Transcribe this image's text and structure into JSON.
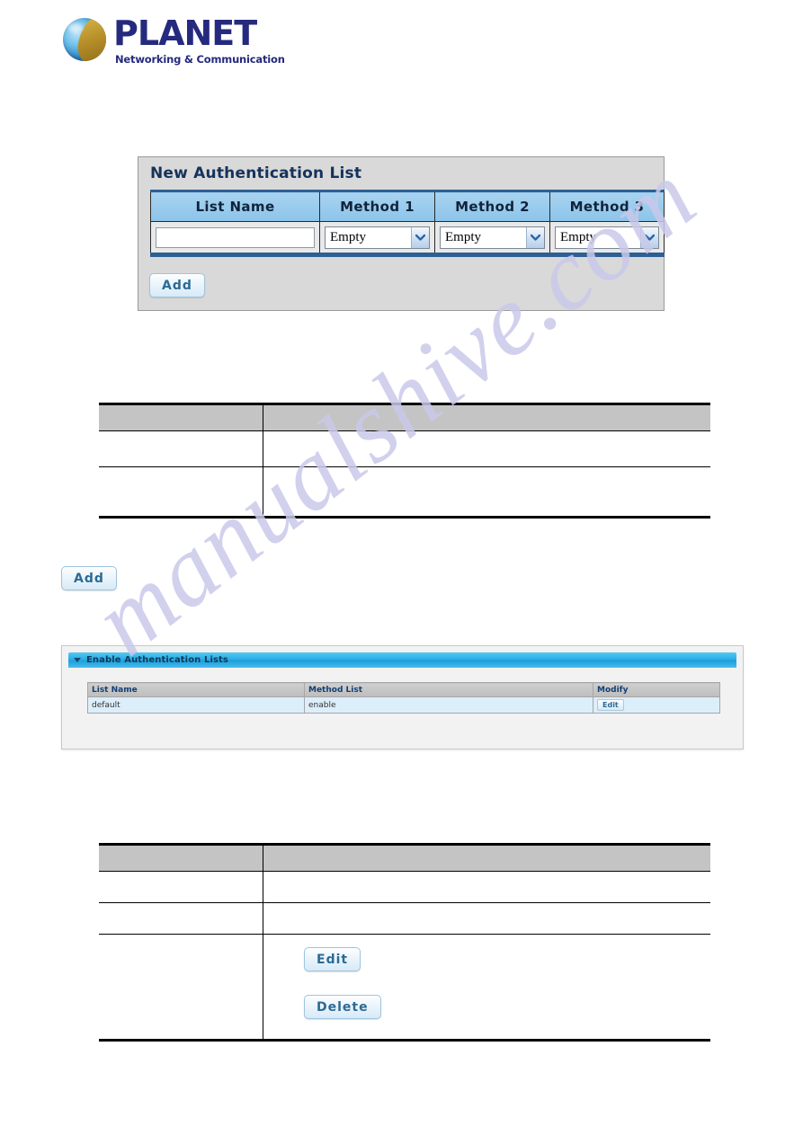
{
  "brand": {
    "name": "PLANET",
    "tagline": "Networking & Communication",
    "logo_icon": "planet-globe-icon",
    "wordmark_color": "#252a7e"
  },
  "watermark": {
    "text": "manualshive.com",
    "color": "#c9c9ea"
  },
  "new_auth_panel": {
    "title": "New Authentication List",
    "columns": [
      "List Name",
      "Method 1",
      "Method 2",
      "Method 3"
    ],
    "list_name_value": "",
    "list_name_placeholder": "",
    "method1_value": "Empty",
    "method2_value": "Empty",
    "method3_value": "Empty",
    "dropdown_icon": "chevron-down-icon",
    "add_label": "Add",
    "header_color": "#8cc4ea",
    "border_color": "#2e5f93"
  },
  "doc_table_1": {
    "header": [
      "",
      ""
    ],
    "rows": [
      [
        "",
        ""
      ],
      [
        "",
        ""
      ]
    ]
  },
  "standalone_add": {
    "label": "Add"
  },
  "enable_auth_panel": {
    "title": "Enable Authentication Lists",
    "caret_icon": "caret-down-icon",
    "columns": [
      "List Name",
      "Method List",
      "Modify"
    ],
    "rows": [
      {
        "list_name": "default",
        "method_list": "enable",
        "modify_label": "Edit"
      }
    ],
    "titlebar_color": "#29aee6",
    "row_color": "#ddeefb"
  },
  "doc_table_2": {
    "header": [
      "",
      ""
    ],
    "rows": [
      [
        "",
        ""
      ],
      [
        "",
        ""
      ],
      [
        "",
        ""
      ]
    ]
  },
  "doc_buttons": {
    "edit_label": "Edit",
    "delete_label": "Delete"
  }
}
